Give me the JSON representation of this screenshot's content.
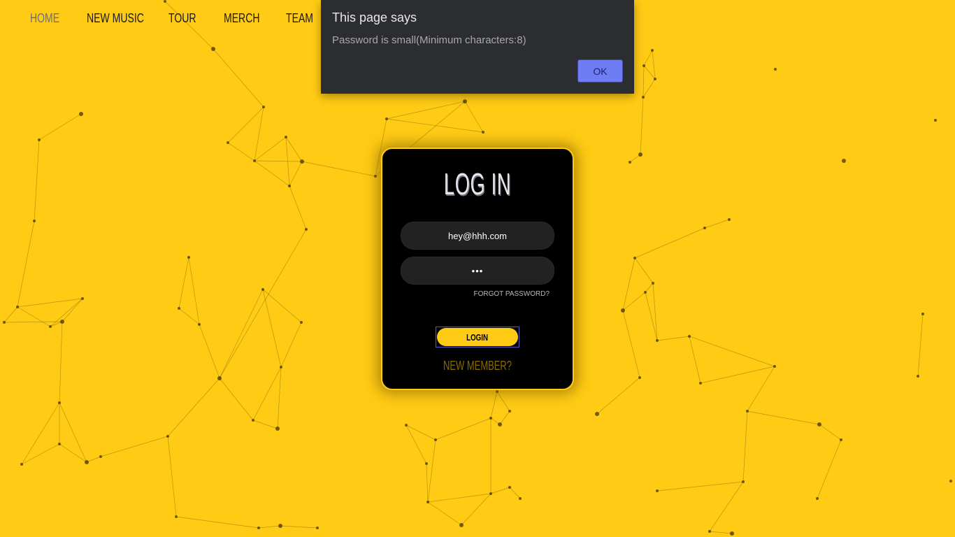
{
  "nav": {
    "items": [
      {
        "label": "HOME",
        "active": true
      },
      {
        "label": "NEW MUSIC",
        "active": false
      },
      {
        "label": "TOUR",
        "active": false
      },
      {
        "label": "MERCH",
        "active": false
      },
      {
        "label": "TEAM",
        "active": false
      }
    ]
  },
  "login": {
    "title": "LOG IN",
    "email_value": "hey@hhh.com",
    "password_value": "abc",
    "forgot_label": "FORGOT PASSWORD?",
    "login_label": "LOGIN",
    "new_member_label": "NEW MEMBER?"
  },
  "dialog": {
    "title": "This page says",
    "message": "Password is small(Minimum characters:8)",
    "ok_label": "OK"
  },
  "colors": {
    "background": "#ffcb14",
    "card": "#000000",
    "accent": "#ffcb14",
    "dialog_bg": "#2b2d31",
    "dialog_button": "#6f7df5"
  }
}
